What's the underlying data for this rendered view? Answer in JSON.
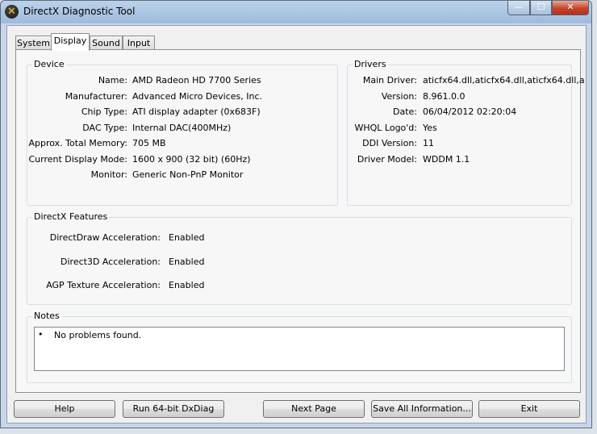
{
  "window": {
    "title": "DirectX Diagnostic Tool",
    "controls": {
      "minimize": "—",
      "maximize": "☐",
      "close": "✕"
    },
    "icon": "directx-x-icon"
  },
  "tabs": [
    {
      "label": "System",
      "active": false
    },
    {
      "label": "Display",
      "active": true
    },
    {
      "label": "Sound",
      "active": false
    },
    {
      "label": "Input",
      "active": false
    }
  ],
  "device": {
    "label": "Device",
    "rows": [
      {
        "label": "Name:",
        "value": "AMD Radeon HD 7700 Series"
      },
      {
        "label": "Manufacturer:",
        "value": "Advanced Micro Devices, Inc."
      },
      {
        "label": "Chip Type:",
        "value": "ATI display adapter (0x683F)"
      },
      {
        "label": "DAC Type:",
        "value": "Internal DAC(400MHz)"
      },
      {
        "label": "Approx. Total Memory:",
        "value": "705 MB"
      },
      {
        "label": "Current Display Mode:",
        "value": "1600 x 900 (32 bit) (60Hz)"
      },
      {
        "label": "Monitor:",
        "value": "Generic Non-PnP Monitor"
      }
    ]
  },
  "drivers": {
    "label": "Drivers",
    "rows": [
      {
        "label": "Main Driver:",
        "value": "aticfx64.dll,aticfx64.dll,aticfx64.dll,a"
      },
      {
        "label": "Version:",
        "value": "8.961.0.0"
      },
      {
        "label": "Date:",
        "value": "06/04/2012 02:20:04"
      },
      {
        "label": "WHQL Logo'd:",
        "value": "Yes"
      },
      {
        "label": "DDI Version:",
        "value": "11"
      },
      {
        "label": "Driver Model:",
        "value": "WDDM 1.1"
      }
    ]
  },
  "features": {
    "label": "DirectX Features",
    "rows": [
      {
        "label": "DirectDraw Acceleration:",
        "value": "Enabled"
      },
      {
        "label": "Direct3D Acceleration:",
        "value": "Enabled"
      },
      {
        "label": "AGP Texture Acceleration:",
        "value": "Enabled"
      }
    ]
  },
  "notes": {
    "label": "Notes",
    "bullet": "•",
    "items": [
      "No problems found."
    ]
  },
  "buttons": {
    "help": "Help",
    "run64": "Run 64-bit DxDiag",
    "next": "Next Page",
    "save": "Save All Information...",
    "exit": "Exit"
  }
}
